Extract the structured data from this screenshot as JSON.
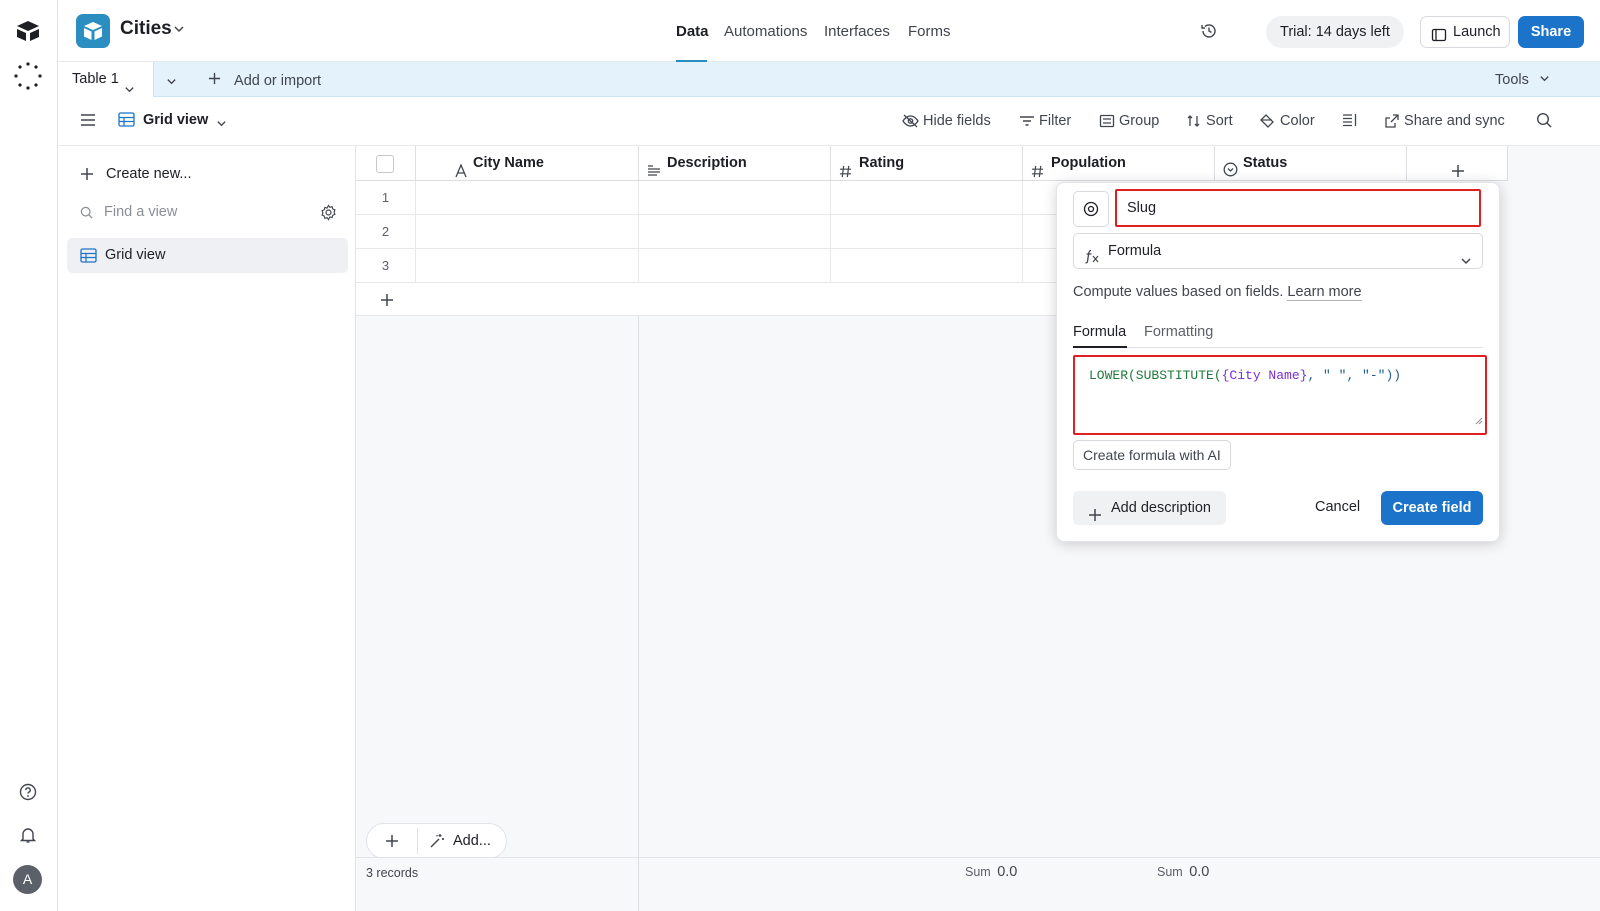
{
  "app": {
    "base_name": "Cities",
    "nav_tabs": [
      "Data",
      "Automations",
      "Interfaces",
      "Forms"
    ],
    "trial": "Trial: 14 days left",
    "launch": "Launch",
    "share": "Share",
    "user_initial": "A"
  },
  "tablebar": {
    "table_name": "Table 1",
    "add_or_import": "Add or import",
    "tools": "Tools"
  },
  "viewbar": {
    "view_name": "Grid view",
    "hide_fields": "Hide fields",
    "filter": "Filter",
    "group": "Group",
    "sort": "Sort",
    "color": "Color",
    "share_sync": "Share and sync"
  },
  "sidebar": {
    "create_new": "Create new...",
    "find_placeholder": "Find a view",
    "views": [
      "Grid view"
    ]
  },
  "grid": {
    "columns": [
      "City Name",
      "Description",
      "Rating",
      "Population",
      "Status"
    ],
    "row_numbers": [
      "1",
      "2",
      "3"
    ],
    "records": "3 records",
    "sum_label": "Sum",
    "sum_rating": "0.0",
    "sum_population": "0.0",
    "add_label": "Add..."
  },
  "field_popup": {
    "field_name": "Slug",
    "field_type": "Formula",
    "help_text": "Compute values based on fields.",
    "learn_more": "Learn more",
    "tabs": [
      "Formula",
      "Formatting"
    ],
    "formula_parts": {
      "fn1": "LOWER(SUBSTITUTE(",
      "field": "{City Name}",
      "rest": ", \" \", \"-\"))"
    },
    "ai_button": "Create formula with AI",
    "add_description": "Add description",
    "cancel": "Cancel",
    "create": "Create field"
  },
  "colors": {
    "accent": "#1b74c9",
    "highlight_border": "#e02020",
    "tablebar_bg": "#e3f2fb"
  }
}
